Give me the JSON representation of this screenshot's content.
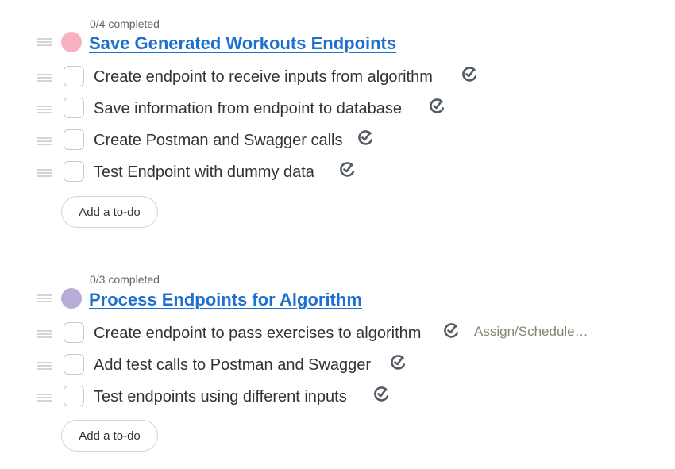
{
  "lists": [
    {
      "progress": "0/4 completed",
      "title": "Save Generated Workouts Endpoints",
      "color": "#f7b2c1",
      "add_label": "Add a to-do",
      "items": [
        {
          "text": "Create endpoint to receive inputs from algorithm",
          "icon": "schedule-icon"
        },
        {
          "text": "Save information from endpoint to database",
          "icon": "schedule-icon"
        },
        {
          "text": "Create Postman and Swagger calls",
          "icon": "schedule-icon"
        },
        {
          "text": "Test Endpoint with dummy data",
          "icon": "schedule-icon"
        }
      ]
    },
    {
      "progress": "0/3 completed",
      "title": "Process Endpoints for Algorithm",
      "color": "#b9acd9",
      "add_label": "Add a to-do",
      "items": [
        {
          "text": "Create endpoint to pass exercises to algorithm",
          "icon": "schedule-icon",
          "assign_label": "Assign/Schedule…"
        },
        {
          "text": "Add test calls to Postman and Swagger",
          "icon": "schedule-icon"
        },
        {
          "text": "Test endpoints using different inputs",
          "icon": "schedule-icon"
        }
      ]
    }
  ]
}
